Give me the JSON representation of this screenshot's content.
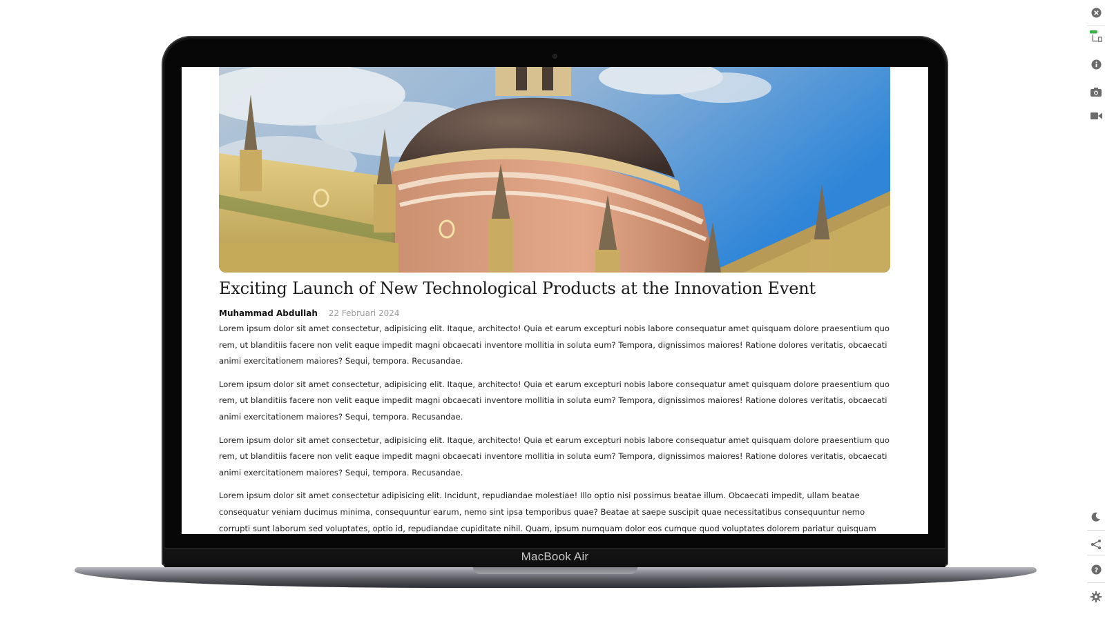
{
  "device": {
    "brand_label": "MacBook Air"
  },
  "article": {
    "hero_image_alt": "Ornate building with dome against a blue sky",
    "title": "Exciting Launch of New Technological Products at the Innovation Event",
    "author": "Muhammad Abdullah",
    "date": "22 Februari 2024",
    "paragraphs": [
      "Lorem ipsum dolor sit amet consectetur, adipisicing elit. Itaque, architecto! Quia et earum excepturi nobis labore consequatur amet quisquam dolore praesentium quo rem, ut blanditiis facere non velit eaque impedit magni obcaecati inventore mollitia in soluta eum? Tempora, dignissimos maiores! Ratione dolores veritatis, obcaecati animi exercitationem maiores? Sequi, tempora. Recusandae.",
      "Lorem ipsum dolor sit amet consectetur, adipisicing elit. Itaque, architecto! Quia et earum excepturi nobis labore consequatur amet quisquam dolore praesentium quo rem, ut blanditiis facere non velit eaque impedit magni obcaecati inventore mollitia in soluta eum? Tempora, dignissimos maiores! Ratione dolores veritatis, obcaecati animi exercitationem maiores? Sequi, tempora. Recusandae.",
      "Lorem ipsum dolor sit amet consectetur, adipisicing elit. Itaque, architecto! Quia et earum excepturi nobis labore consequatur amet quisquam dolore praesentium quo rem, ut blanditiis facere non velit eaque impedit magni obcaecati inventore mollitia in soluta eum? Tempora, dignissimos maiores! Ratione dolores veritatis, obcaecati animi exercitationem maiores? Sequi, tempora. Recusandae.",
      "Lorem ipsum dolor sit amet consectetur adipisicing elit. Incidunt, repudiandae molestiae! Illo optio nisi possimus beatae illum. Obcaecati impedit, ullam beatae consequatur veniam ducimus minima, consequuntur earum, nemo sint ipsa temporibus quae? Beatae at saepe suscipit quae necessitatibus consequuntur nemo corrupti sunt laborum sed voluptates, optio id, repudiandae cupiditate nihil. Quam, ipsum numquam dolor eos cumque quod voluptates dolorem pariatur quisquam"
    ]
  },
  "toolbar": {
    "icons": [
      "close-icon",
      "responsive-devices-icon",
      "info-icon",
      "camera-icon",
      "video-icon",
      "dark-mode-moon-icon",
      "share-icon",
      "help-icon",
      "settings-gear-icon"
    ],
    "new_badge_color": "#3cb24a",
    "icon_color": "#6b6b6b"
  },
  "colors": {
    "page_background": "#ffffff",
    "laptop_bezel": "#060606",
    "title_text": "#1a1a1a",
    "body_text": "#222222",
    "date_text": "#9a9a9a"
  }
}
